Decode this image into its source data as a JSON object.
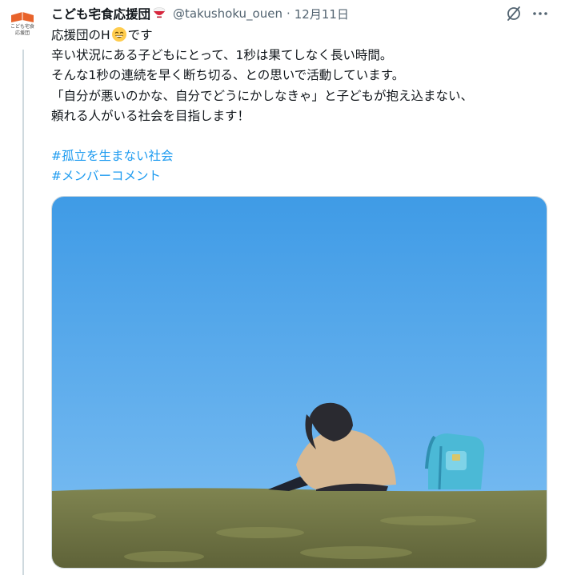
{
  "author": {
    "display_name": "こども宅食応援団",
    "handle": "@takushoku_ouen",
    "separator": "·",
    "date": "12月11日",
    "avatar_text": [
      "こども宅食",
      "応援団"
    ],
    "name_emoji": "rice-bowl-icon"
  },
  "tweet": {
    "lines": [
      {
        "before": "応援団のH",
        "after": "です"
      },
      "辛い状況にある子どもにとって、1秒は果てしなく長い時間。",
      "そんな1秒の連続を早く断ち切る、との思いで活動しています。",
      "「自分が悪いのかな、自分でどうにかしなきゃ」と子どもが抱え込まない、",
      "頼れる人がいる社会を目指します！"
    ],
    "hashtags": [
      "#孤立を生まない社会",
      "#メンバーコメント"
    ],
    "emoji": "grinning-face-icon"
  },
  "colors": {
    "link": "#1d9bf0",
    "secondary_text": "#536471",
    "sky_top": "#3f9be6",
    "sky_bottom": "#72b8f0",
    "grass": "#6f7442",
    "backpack": "#4bb9d6"
  },
  "icons": {
    "grok": "grok-icon",
    "more": "more-horizontal-icon"
  }
}
